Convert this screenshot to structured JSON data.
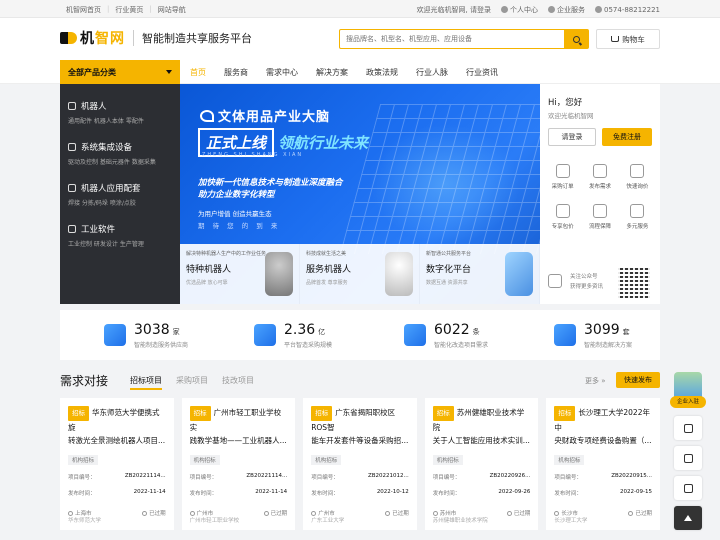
{
  "topbar": {
    "links": [
      "机智网首页",
      "行业黄页",
      "网站导航"
    ],
    "welcome": "欢迎光临机智网, 请登录",
    "user_center": "个人中心",
    "enterprise": "企业服务",
    "phone": "0574-88212221"
  },
  "header": {
    "logo_a": "机",
    "logo_b": "智网",
    "slogan": "智能制造共享服务平台",
    "search_placeholder": "搜品牌名、机型名、机型应用、应用设备",
    "cart": "购物车"
  },
  "nav": {
    "allcat": "全部产品分类",
    "links": [
      "首页",
      "服务商",
      "需求中心",
      "解决方案",
      "政策法规",
      "行业人脉",
      "行业资讯"
    ],
    "active": 0
  },
  "categories": [
    {
      "title": "机器人",
      "sub": "通用配件  机器人本体  零配件"
    },
    {
      "title": "系统集成设备",
      "sub": "驱动及控制  基础元器件  数据采集"
    },
    {
      "title": "机器人应用配套",
      "sub": "焊接  分拣/码垛  喷涂/点胶"
    },
    {
      "title": "工业软件",
      "sub": "工业控制  研发设计  生产管理"
    }
  ],
  "banner": {
    "brand": "文体用品产业大脑",
    "launch_box": "正式上线",
    "launch_lead": "领航行业未来",
    "pinyin": "ZHENG SHI SHANG XIAN",
    "line1": "加快新一代信息技术与制造业深度融合",
    "line2": "助力企业数字化转型",
    "line3": "为用户增值  创造共赢生态",
    "line4": "期 待 您 的 到 来"
  },
  "promos": [
    {
      "top": "解决特种机器人生产中的工作业任务",
      "title": "特种机器人",
      "sub": "优选品牌  放心可靠"
    },
    {
      "top": "科技成就生活之美",
      "title": "服务机器人",
      "sub": "品牌首发  尊享服务"
    },
    {
      "top": "新智通公共服务平台",
      "title": "数字化平台",
      "sub": "数据互通  资源共享"
    }
  ],
  "login": {
    "hi": "Hi，您好",
    "welcome": "欢迎光临机智网",
    "login_btn": "请登录",
    "register_btn": "免费注册",
    "grid": [
      "采购订单",
      "发布需求",
      "快速询价",
      "专享包价",
      "流程保障",
      "多元服务"
    ],
    "qr_text1": "关注公众号",
    "qr_text2": "获得更多资讯"
  },
  "stats": [
    {
      "num": "3038",
      "unit": "家",
      "label": "智能制造服务供应商"
    },
    {
      "num": "2.36",
      "unit": "亿",
      "label": "平台智造采购规模"
    },
    {
      "num": "6022",
      "unit": "条",
      "label": "智能化改造项目需求"
    },
    {
      "num": "3099",
      "unit": "套",
      "label": "智能制造解决方案"
    }
  ],
  "demand": {
    "title": "需求对接",
    "tabs": [
      "招标项目",
      "采购项目",
      "技改项目"
    ],
    "more": "更多 »",
    "publish": "快速发布",
    "tag": "招标",
    "cat_tag": "机构招标",
    "no_label": "项目编号：",
    "date_label": "发布时间：",
    "status": "已过期",
    "cards": [
      {
        "title1": "华东师范大学便携式旋",
        "title2": "转激光全景测绘机器人项目...",
        "no": "ZB20221114...",
        "date": "2022-11-14",
        "city": "上海市",
        "org": "华东师范大学"
      },
      {
        "title1": "广州市轻工职业学校实",
        "title2": "践教学基地——工业机器人...",
        "no": "ZB20221114...",
        "date": "2022-11-14",
        "city": "广州市",
        "org": "广州市轻工职业学校"
      },
      {
        "title1": "广东省揭阳职校区ROS智",
        "title2": "能车开发套件等设备采购招...",
        "no": "ZB20221012...",
        "date": "2022-10-12",
        "city": "广州市",
        "org": "广东工业大学"
      },
      {
        "title1": "苏州健雄职业技术学院",
        "title2": "关于人工智能应用技术实训...",
        "no": "ZB20220926...",
        "date": "2022-09-26",
        "city": "苏州市",
        "org": "苏州健雄职业技术学院"
      },
      {
        "title1": "长沙理工大学2022年中",
        "title2": "央财政专项经费设备购置（...",
        "no": "ZB20220915...",
        "date": "2022-09-15",
        "city": "长沙市",
        "org": "长沙理工大学"
      }
    ]
  },
  "floatbar": {
    "join": "企业入驻"
  }
}
